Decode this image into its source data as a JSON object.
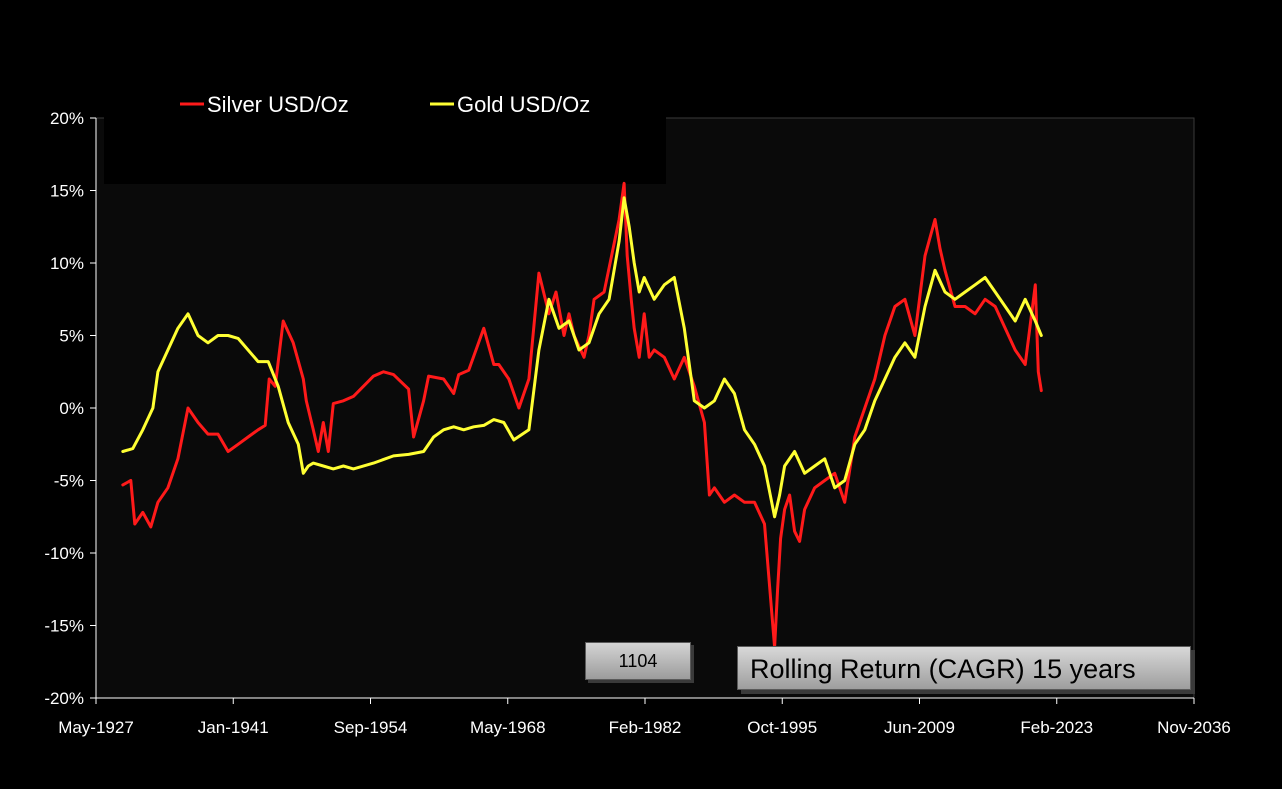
{
  "chart_data": {
    "type": "line",
    "title": "Rolling Return (CAGR) 15 years",
    "xlabel": "",
    "ylabel": "",
    "x_ticks": [
      "May-1927",
      "Jan-1941",
      "Sep-1954",
      "May-1968",
      "Feb-1982",
      "Oct-1995",
      "Jun-2009",
      "Feb-2023",
      "Nov-2036"
    ],
    "x_range": [
      1927.33,
      2036.83
    ],
    "y_ticks": [
      "20%",
      "15%",
      "10%",
      "5%",
      "0%",
      "-5%",
      "-10%",
      "-15%",
      "-20%"
    ],
    "ylim": [
      -20,
      20
    ],
    "y_unit": "%",
    "legend_position": "top-left",
    "grid": false,
    "counter_label": "1104",
    "series": [
      {
        "name": "Silver USD/Oz",
        "color": "#ff1a1a",
        "x": [
          1930.0,
          1930.8,
          1931.2,
          1932.0,
          1932.8,
          1933.5,
          1934.5,
          1935.5,
          1936.5,
          1937.5,
          1938.5,
          1939.5,
          1940.5,
          1941.5,
          1942.5,
          1943.5,
          1944.2,
          1944.6,
          1945.2,
          1946.0,
          1947.0,
          1948.0,
          1948.3,
          1949.0,
          1949.5,
          1950.0,
          1950.5,
          1951.0,
          1952.0,
          1953.0,
          1954.0,
          1955.0,
          1956.0,
          1957.0,
          1958.5,
          1959.0,
          1960.0,
          1960.5,
          1962.0,
          1963.0,
          1963.5,
          1964.5,
          1966.0,
          1967.0,
          1967.5,
          1968.5,
          1969.5,
          1970.5,
          1971.5,
          1972.5,
          1973.2,
          1974.0,
          1974.5,
          1975.0,
          1976.0,
          1976.5,
          1977.0,
          1978.0,
          1979.5,
          1980.0,
          1980.3,
          1980.7,
          1981.0,
          1981.5,
          1982.0,
          1982.5,
          1983.0,
          1984.0,
          1985.0,
          1986.0,
          1987.0,
          1988.0,
          1988.5,
          1989.0,
          1990.0,
          1991.0,
          1992.0,
          1993.0,
          1994.0,
          1995.0,
          1995.3,
          1995.6,
          1996.0,
          1996.5,
          1997.0,
          1997.5,
          1998.0,
          1999.0,
          2000.0,
          2001.0,
          2002.0,
          2003.0,
          2004.0,
          2005.0,
          2006.0,
          2007.0,
          2008.0,
          2009.0,
          2010.0,
          2011.0,
          2011.5,
          2012.0,
          2013.0,
          2014.0,
          2015.0,
          2016.0,
          2017.0,
          2018.0,
          2019.0,
          2020.0,
          2021.0,
          2021.3,
          2021.6
        ],
        "y": [
          -5.3,
          -5.0,
          -8.0,
          -7.2,
          -8.2,
          -6.5,
          -5.5,
          -3.5,
          0.0,
          -1.0,
          -1.8,
          -1.8,
          -3.0,
          -2.5,
          -2.0,
          -1.5,
          -1.2,
          2.0,
          1.5,
          6.0,
          4.5,
          2.0,
          0.5,
          -1.5,
          -3.0,
          -1.0,
          -3.0,
          0.3,
          0.5,
          0.8,
          1.5,
          2.2,
          2.5,
          2.3,
          1.3,
          -2.0,
          0.5,
          2.2,
          2.0,
          1.0,
          2.3,
          2.6,
          5.5,
          3.0,
          3.0,
          2.0,
          0.0,
          2.0,
          9.3,
          6.5,
          8.0,
          5.0,
          6.5,
          5.0,
          3.5,
          5.0,
          7.5,
          8.0,
          13.0,
          15.5,
          10.5,
          7.5,
          5.5,
          3.5,
          6.5,
          3.5,
          4.0,
          3.5,
          2.0,
          3.5,
          1.5,
          -1.0,
          -6.0,
          -5.5,
          -6.5,
          -6.0,
          -6.5,
          -6.5,
          -8.0,
          -16.5,
          -12.5,
          -9.0,
          -7.0,
          -6.0,
          -8.5,
          -9.2,
          -7.0,
          -5.5,
          -5.0,
          -4.5,
          -6.5,
          -2.0,
          0.0,
          2.0,
          5.0,
          7.0,
          7.5,
          5.0,
          10.5,
          13.0,
          11.0,
          9.5,
          7.0,
          7.0,
          6.5,
          7.5,
          7.0,
          5.5,
          4.0,
          3.0,
          8.5,
          2.5,
          1.2
        ]
      },
      {
        "name": "Gold USD/Oz",
        "color": "#ffff33",
        "x": [
          1930.0,
          1931.0,
          1932.0,
          1933.0,
          1933.5,
          1934.5,
          1935.5,
          1936.5,
          1937.5,
          1938.5,
          1939.5,
          1940.5,
          1941.5,
          1942.5,
          1943.5,
          1944.5,
          1945.5,
          1946.5,
          1947.5,
          1948.0,
          1948.5,
          1949.0,
          1950.0,
          1951.0,
          1952.0,
          1953.0,
          1955.0,
          1957.0,
          1958.5,
          1960.0,
          1961.0,
          1962.0,
          1963.0,
          1964.0,
          1965.0,
          1966.0,
          1967.0,
          1968.0,
          1969.0,
          1970.5,
          1971.5,
          1972.5,
          1973.5,
          1974.5,
          1975.5,
          1976.5,
          1977.5,
          1978.5,
          1979.5,
          1980.0,
          1980.5,
          1981.0,
          1981.5,
          1982.0,
          1983.0,
          1984.0,
          1985.0,
          1986.0,
          1987.0,
          1988.0,
          1989.0,
          1990.0,
          1991.0,
          1992.0,
          1993.0,
          1994.0,
          1995.0,
          1995.5,
          1996.0,
          1997.0,
          1998.0,
          1999.0,
          2000.0,
          2001.0,
          2002.0,
          2003.0,
          2004.0,
          2005.0,
          2006.0,
          2007.0,
          2008.0,
          2009.0,
          2010.0,
          2011.0,
          2012.0,
          2013.0,
          2014.0,
          2015.0,
          2016.0,
          2017.0,
          2018.0,
          2019.0,
          2020.0,
          2021.0,
          2021.6
        ],
        "y": [
          -3.0,
          -2.8,
          -1.5,
          0.0,
          2.5,
          4.0,
          5.5,
          6.5,
          5.0,
          4.5,
          5.0,
          5.0,
          4.8,
          4.0,
          3.2,
          3.2,
          1.5,
          -1.0,
          -2.5,
          -4.5,
          -4.0,
          -3.8,
          -4.0,
          -4.2,
          -4.0,
          -4.2,
          -3.8,
          -3.3,
          -3.2,
          -3.0,
          -2.0,
          -1.5,
          -1.3,
          -1.5,
          -1.3,
          -1.2,
          -0.8,
          -1.0,
          -2.2,
          -1.5,
          4.0,
          7.5,
          5.5,
          6.0,
          4.0,
          4.5,
          6.5,
          7.5,
          11.5,
          14.5,
          12.5,
          10.0,
          8.0,
          9.0,
          7.5,
          8.5,
          9.0,
          5.5,
          0.5,
          0.0,
          0.5,
          2.0,
          1.0,
          -1.5,
          -2.5,
          -4.0,
          -7.5,
          -6.0,
          -4.0,
          -3.0,
          -4.5,
          -4.0,
          -3.5,
          -5.5,
          -5.0,
          -2.5,
          -1.5,
          0.5,
          2.0,
          3.5,
          4.5,
          3.5,
          7.0,
          9.5,
          8.0,
          7.5,
          8.0,
          8.5,
          9.0,
          8.0,
          7.0,
          6.0,
          7.5,
          6.0,
          5.0
        ]
      }
    ]
  }
}
